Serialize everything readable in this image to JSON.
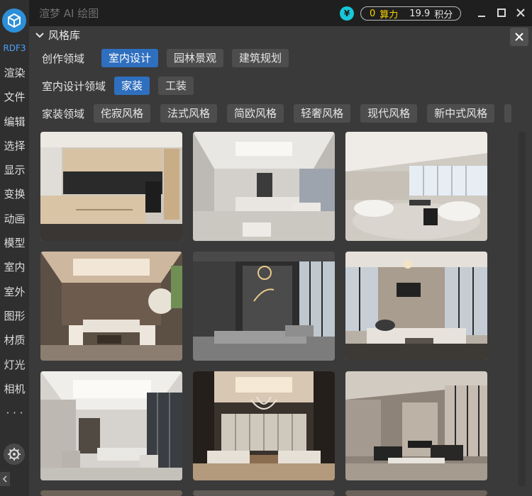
{
  "sidebar": {
    "version": "RDF3",
    "items": [
      "渲染",
      "文件",
      "编辑",
      "选择",
      "显示",
      "变换",
      "动画",
      "模型",
      "室内",
      "室外",
      "图形",
      "材质",
      "灯光",
      "相机"
    ],
    "more": "· · ·"
  },
  "window": {
    "title": "渲梦 AI 绘图",
    "currency_symbol": "¥",
    "compute_value": "0",
    "compute_label": "算力",
    "points_value": "19.9",
    "points_label": "积分"
  },
  "panel": {
    "title": "风格库",
    "domain_row": {
      "label": "创作领域",
      "chips": [
        "室内设计",
        "园林景观",
        "建筑规划"
      ],
      "active": 0
    },
    "interior_row": {
      "label": "室内设计领域",
      "chips": [
        "家装",
        "工装"
      ],
      "active": 0
    },
    "home_row": {
      "label": "家装领域",
      "chips": [
        "侘寂风格",
        "法式风格",
        "简欧风格",
        "轻奢风格",
        "现代风格",
        "新中式风格"
      ],
      "active": -1
    }
  },
  "gallery": {
    "items": [
      "kitchen",
      "living-room-white-ceiling",
      "living-room-round-sofa",
      "living-room-wood-ceiling",
      "living-room-double-height-dark",
      "living-room-city-view",
      "living-room-glass-partition",
      "living-room-chandelier",
      "living-room-fireplace"
    ]
  },
  "colors": {
    "accent": "#2f6fbf",
    "compute": "#ffd400",
    "currency": "#18c7d8",
    "logo": "#2e8fd9"
  }
}
